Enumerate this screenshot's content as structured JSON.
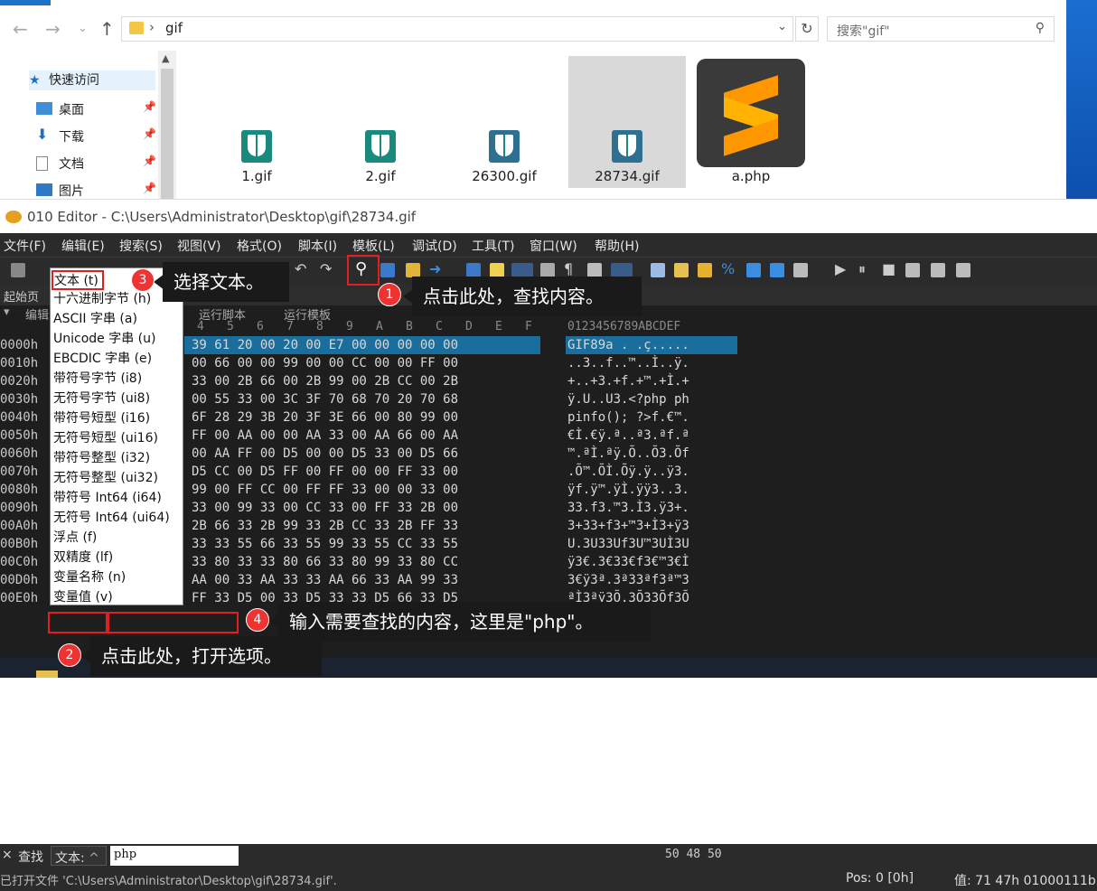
{
  "explorer": {
    "address": "gif",
    "search_placeholder": "搜索\"gif\"",
    "sidebar": [
      {
        "label": "快速访问",
        "icon": "star-icon"
      },
      {
        "label": "桌面",
        "icon": "desktop-icon"
      },
      {
        "label": "下载",
        "icon": "download-icon"
      },
      {
        "label": "文档",
        "icon": "document-icon"
      },
      {
        "label": "图片",
        "icon": "picture-icon"
      }
    ],
    "files": [
      {
        "name": "1.gif"
      },
      {
        "name": "2.gif"
      },
      {
        "name": "26300.gif"
      },
      {
        "name": "28734.gif"
      },
      {
        "name": "a.php"
      }
    ]
  },
  "editor": {
    "title": "010 Editor - C:\\Users\\Administrator\\Desktop\\gif\\28734.gif",
    "menus": [
      "文件(F)",
      "编辑(E)",
      "搜索(S)",
      "视图(V)",
      "格式(O)",
      "脚本(I)",
      "模板(L)",
      "调试(D)",
      "工具(T)",
      "窗口(W)",
      "帮助(H)"
    ],
    "tabs": {
      "start": "起始页",
      "edit": "编辑",
      "run_script": "运行脚本",
      "run_template": "运行模板"
    },
    "hex_columns": [
      "4",
      "5",
      "6",
      "7",
      "8",
      "9",
      "A",
      "B",
      "C",
      "D",
      "E",
      "F"
    ],
    "ascii_header": "0123456789ABCDEF",
    "rows": [
      {
        "addr": "0000h",
        "hex": "39 61 20 00 20 00 E7 00 00 00 00 00",
        "ascii": "GIF89a . .ç....."
      },
      {
        "addr": "0010h",
        "hex": "00 66 00 00 99 00 00 CC 00 00 FF 00",
        "ascii": "..3..f..™..Ì..ÿ."
      },
      {
        "addr": "0020h",
        "hex": "33 00 2B 66 00 2B 99 00 2B CC 00 2B",
        "ascii": "+..+3.+f.+™.+Ì.+"
      },
      {
        "addr": "0030h",
        "hex": "00 55 33 00 3C 3F 70 68 70 20 70 68",
        "ascii": "ÿ.U..U3.<?php ph"
      },
      {
        "addr": "0040h",
        "hex": "6F 28 29 3B 20 3F 3E 66 00 80 99 00",
        "ascii": "pinfo(); ?>f.€™."
      },
      {
        "addr": "0050h",
        "hex": "FF 00 AA 00 00 AA 33 00 AA 66 00 AA",
        "ascii": "€Ì.€ÿ.ª..ª3.ªf.ª"
      },
      {
        "addr": "0060h",
        "hex": "00 AA FF 00 D5 00 00 D5 33 00 D5 66",
        "ascii": "™.ªÌ.ªÿ.Õ..Õ3.Õf"
      },
      {
        "addr": "0070h",
        "hex": "D5 CC 00 D5 FF 00 FF 00 00 FF 33 00",
        "ascii": ".Õ™.ÕÌ.Õÿ.ÿ..ÿ3."
      },
      {
        "addr": "0080h",
        "hex": "99 00 FF CC 00 FF FF 33 00 00 33 00",
        "ascii": "ÿf.ÿ™.ÿÌ.ÿÿ3..3."
      },
      {
        "addr": "0090h",
        "hex": "33 00 99 33 00 CC 33 00 FF 33 2B 00",
        "ascii": "33.f3.™3.Ì3.ÿ3+."
      },
      {
        "addr": "00A0h",
        "hex": "2B 66 33 2B 99 33 2B CC 33 2B FF 33",
        "ascii": "3+33+f3+™3+Ì3+ÿ3"
      },
      {
        "addr": "00B0h",
        "hex": "33 33 55 66 33 55 99 33 55 CC 33 55",
        "ascii": "U.3U33Uf3U™3UÌ3U"
      },
      {
        "addr": "00C0h",
        "hex": "33 80 33 33 80 66 33 80 99 33 80 CC",
        "ascii": "ÿ3€.3€33€f3€™3€Ì"
      },
      {
        "addr": "00D0h",
        "hex": "AA 00 33 AA 33 33 AA 66 33 AA 99 33",
        "ascii": "3€ÿ3ª.3ª33ªf3ª™3"
      },
      {
        "addr": "00E0h",
        "hex": "FF 33 D5 00 33 D5 33 33 D5 66 33 D5",
        "ascii": "ªÌ3ªÿ3Õ.3Õ33Õf3Õ"
      }
    ],
    "dropdown": [
      "文本 (t)",
      "十六进制字节 (h)",
      "ASCII 字串 (a)",
      "Unicode 字串 (u)",
      "EBCDIC 字串 (e)",
      "带符号字节 (i8)",
      "无符号字节 (ui8)",
      "带符号短型 (i16)",
      "无符号短型 (ui16)",
      "带符号整型 (i32)",
      "无符号整型 (ui32)",
      "带符号 Int64 (i64)",
      "无符号 Int64 (ui64)",
      "浮点 (f)",
      "双精度 (lf)",
      "变量名称 (n)",
      "变量值 (v)"
    ],
    "findbar": {
      "close": "×",
      "label": "查找",
      "type": "文本:",
      "query": "php",
      "hex": "50 48 50"
    },
    "status": {
      "opened": "已打开文件 'C:\\Users\\Administrator\\Desktop\\gif\\28734.gif'.",
      "pos": "Pos: 0 [0h]",
      "value": "值: 71 47h 01000111b"
    }
  },
  "callouts": [
    {
      "num": "1",
      "text": "点击此处，查找内容。"
    },
    {
      "num": "2",
      "text": "点击此处，打开选项。"
    },
    {
      "num": "3",
      "text": "选择文本。"
    },
    {
      "num": "4",
      "text": "输入需要查找的内容，这里是\"php\"。"
    }
  ]
}
